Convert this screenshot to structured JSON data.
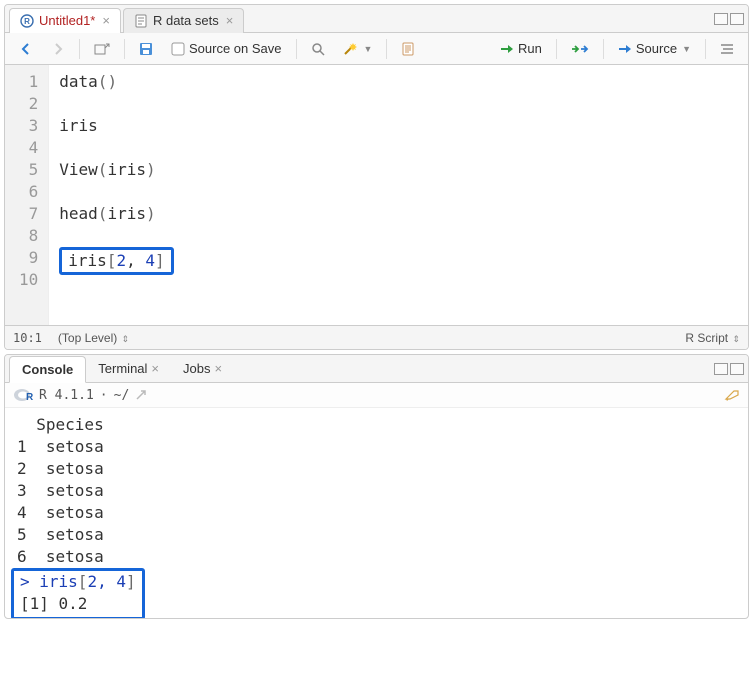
{
  "editor": {
    "tabs": [
      {
        "label": "Untitled1*",
        "unsaved": true,
        "icon": "r-file-icon"
      },
      {
        "label": "R data sets",
        "unsaved": false,
        "icon": "text-file-icon"
      }
    ],
    "toolbar": {
      "source_on_save": "Source on Save",
      "run": "Run",
      "source": "Source"
    },
    "lines": [
      "data()",
      "",
      "iris",
      "",
      "View(iris)",
      "",
      "head(iris)",
      "",
      "iris[2, 4]",
      ""
    ],
    "highlighted_line_index": 8,
    "status": {
      "pos": "10:1",
      "scope": "(Top Level)",
      "lang": "R Script"
    }
  },
  "console": {
    "tabs": [
      "Console",
      "Terminal",
      "Jobs"
    ],
    "active_tab": 0,
    "version": "R 4.1.1",
    "path": "~/",
    "output_lines": [
      "  Species",
      "1  setosa",
      "2  setosa",
      "3  setosa",
      "4  setosa",
      "5  setosa",
      "6  setosa"
    ],
    "command": "iris[2, 4]",
    "result": "[1] 0.2",
    "prompt": ">"
  }
}
